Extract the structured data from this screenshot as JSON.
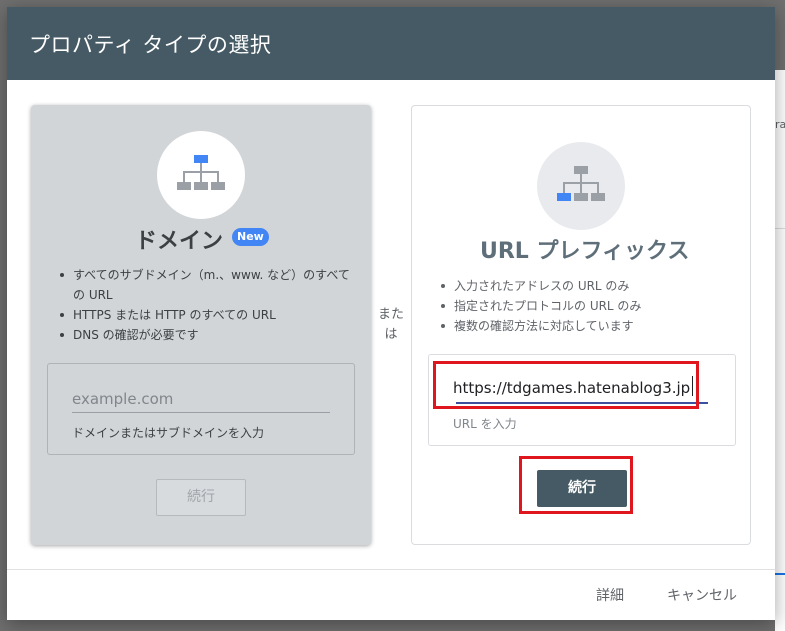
{
  "dialog": {
    "title": "プロパティ タイプの選択",
    "or_label": "または"
  },
  "domain_card": {
    "icon": "sitemap-icon",
    "title": "ドメイン",
    "badge": "New",
    "features": [
      "すべてのサブドメイン（m.、www. など）のすべての URL",
      "HTTPS または HTTP のすべての URL",
      "DNS の確認が必要です"
    ],
    "input": {
      "value": "",
      "placeholder": "example.com",
      "hint": "ドメインまたはサブドメインを入力"
    },
    "continue_label": "続行"
  },
  "url_card": {
    "icon": "sitemap-icon",
    "title": "URL プレフィックス",
    "features": [
      "入力されたアドレスの URL のみ",
      "指定されたプロトコルの URL のみ",
      "複数の確認方法に対応しています"
    ],
    "input": {
      "value": "https://tdgames.hatenablog3.jp",
      "hint": "URL を入力"
    },
    "continue_label": "続行"
  },
  "footer": {
    "details_label": "詳細",
    "cancel_label": "キャンセル"
  },
  "backdrop": {
    "fragment": "ra"
  },
  "colors": {
    "header": "#455a64",
    "accent_blue": "#4285f4",
    "highlight": "#e0161e"
  }
}
